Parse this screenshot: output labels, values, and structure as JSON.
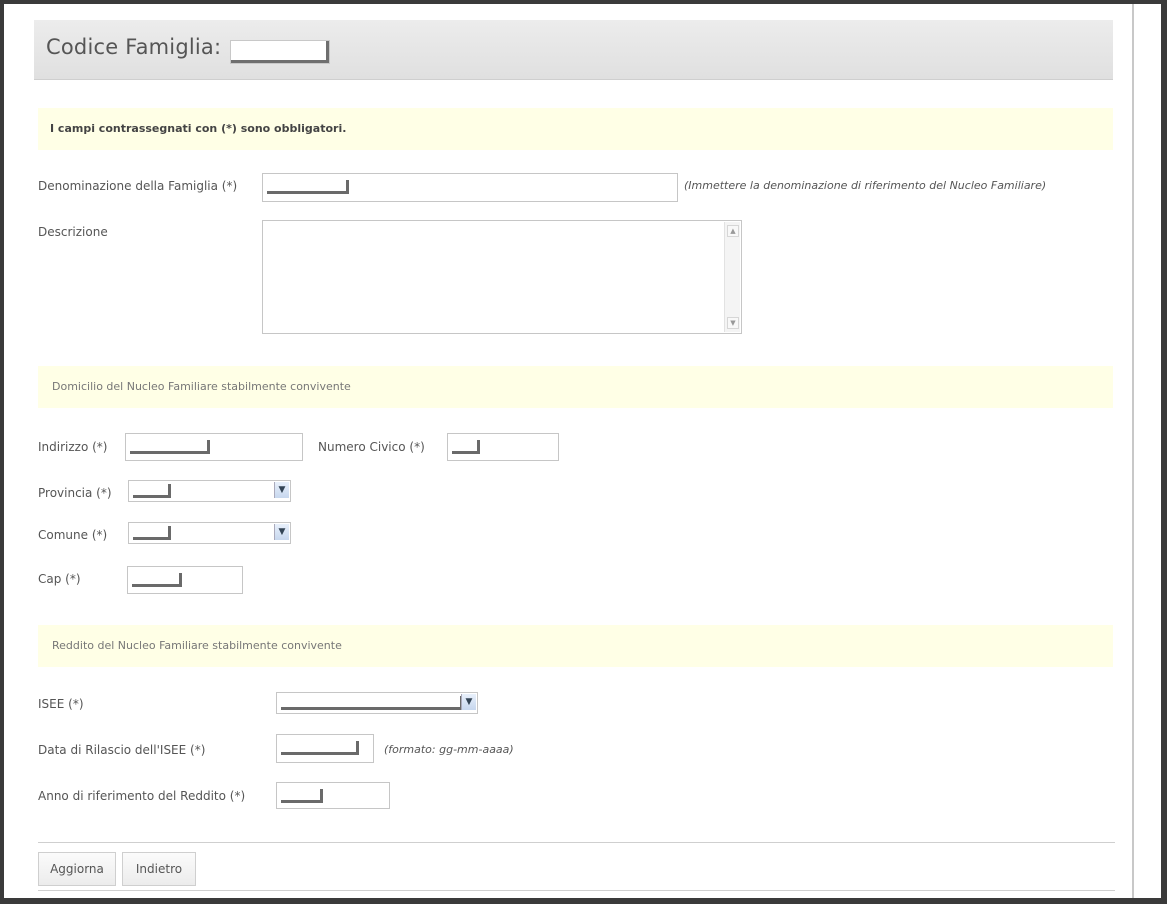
{
  "header": {
    "title": "Codice Famiglia:"
  },
  "notice": "I campi contrassegnati con (*) sono obbligatori.",
  "family": {
    "denominazione_label": "Denominazione della Famiglia (*)",
    "denominazione_hint": "(Immettere la denominazione di riferimento del Nucleo Familiare)",
    "descrizione_label": "Descrizione"
  },
  "domicilio": {
    "section_title": "Domicilio del Nucleo Familiare stabilmente convivente",
    "indirizzo_label": "Indirizzo (*)",
    "numero_civico_label": "Numero Civico (*)",
    "provincia_label": "Provincia (*)",
    "comune_label": "Comune (*)",
    "cap_label": "Cap (*)"
  },
  "reddito": {
    "section_title": "Reddito del Nucleo Familiare stabilmente convivente",
    "isee_label": "ISEE (*)",
    "data_rilascio_label": "Data di Rilascio dell'ISEE (*)",
    "data_rilascio_hint": "(formato: gg-mm-aaaa)",
    "anno_label": "Anno di riferimento del Reddito (*)"
  },
  "buttons": {
    "update": "Aggiorna",
    "back": "Indietro"
  },
  "icons": {
    "select_arrow": "chevron-down-icon"
  }
}
